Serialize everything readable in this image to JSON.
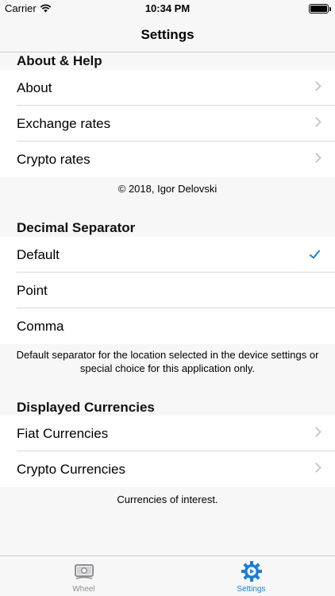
{
  "status_bar": {
    "carrier": "Carrier",
    "time": "10:34 PM"
  },
  "nav": {
    "title": "Settings"
  },
  "sections": {
    "about": {
      "header": "About & Help",
      "items": [
        "About",
        "Exchange rates",
        "Crypto rates"
      ],
      "footer": "© 2018, Igor Delovski"
    },
    "decimal": {
      "header": "Decimal Separator",
      "items": [
        "Default",
        "Point",
        "Comma"
      ],
      "selected": "Default",
      "footer": "Default separator for the location selected in the device settings or special choice for this application only."
    },
    "currencies": {
      "header": "Displayed Currencies",
      "items": [
        "Fiat Currencies",
        "Crypto Currencies"
      ],
      "footer": "Currencies of interest."
    }
  },
  "tab_bar": {
    "tabs": [
      {
        "label": "Wheel",
        "icon": "banknote-icon",
        "active": false
      },
      {
        "label": "Settings",
        "icon": "gear-icon",
        "active": true
      }
    ],
    "active_color": "#1a7fd4",
    "inactive_color": "#8e8e93"
  },
  "colors": {
    "accent": "#1a7fd4",
    "chevron": "#c7c7cc",
    "background": "#f7f7f7"
  }
}
